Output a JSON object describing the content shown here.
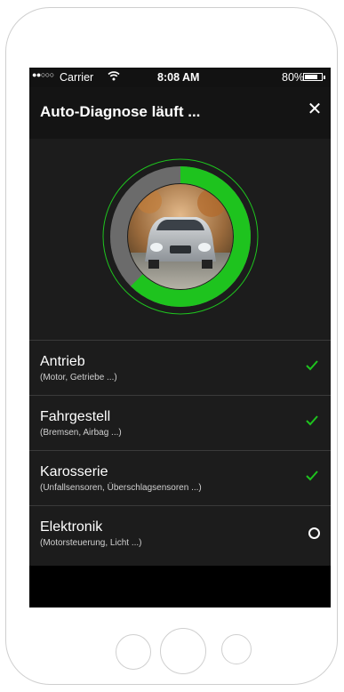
{
  "status_bar": {
    "signal": "●●○○○",
    "carrier": "Carrier",
    "wifi_icon": "wifi-icon",
    "time": "8:08 AM",
    "battery": "80%",
    "battery_level": 0.8
  },
  "header": {
    "title": "Auto-Diagnose läuft ...",
    "close_icon": "close-icon",
    "close_glyph": "✕"
  },
  "progress": {
    "value": 0.625,
    "accent": "#1ec31e",
    "track": "#6b6b6b"
  },
  "checks": [
    {
      "label": "Antrieb",
      "sub": "(Motor, Getriebe ...)",
      "status": "done"
    },
    {
      "label": "Fahrgestell",
      "sub": "(Bremsen, Airbag ...)",
      "status": "done"
    },
    {
      "label": "Karosserie",
      "sub": "(Unfallsensoren, Überschlagsensoren ...)",
      "status": "done"
    },
    {
      "label": "Elektronik",
      "sub": "(Motorsteuerung, Licht ...)",
      "status": "pending"
    }
  ],
  "colors": {
    "background": "#1c1c1c",
    "check": "#1ec31e",
    "text": "#ffffff"
  }
}
